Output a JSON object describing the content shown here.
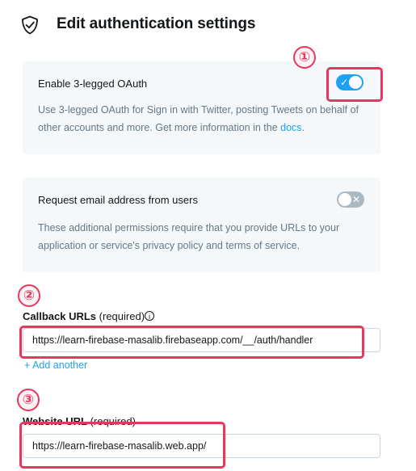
{
  "header": {
    "title": "Edit authentication settings",
    "icon": "shield-icon"
  },
  "oauth": {
    "title": "Enable 3-legged OAuth",
    "description_prefix": "Use 3-legged OAuth for Sign in with Twitter, posting Tweets on behalf of other accounts and more. Get more information in the ",
    "link": "docs",
    "description_suffix": ".",
    "enabled": true
  },
  "email": {
    "title": "Request email address from users",
    "description": "These additional permissions require that you provide URLs to your application or service's privacy policy and terms of service.",
    "enabled": false
  },
  "callback": {
    "label": "Callback URLs",
    "required": "(required)",
    "value": "https://learn-firebase-masalib.firebaseapp.com/__/auth/handler",
    "add_another": "+ Add another"
  },
  "website": {
    "label": "Website URL",
    "required": "(required)",
    "value": "https://learn-firebase-masalib.web.app/"
  },
  "annotations": [
    "①",
    "②",
    "③"
  ],
  "colors": {
    "accent": "#1da1f2",
    "highlight": "#e8375f",
    "card_bg": "#f5f8fa",
    "muted_text": "#657786"
  },
  "toggle_marks": {
    "on": "✓",
    "off": "✕"
  }
}
